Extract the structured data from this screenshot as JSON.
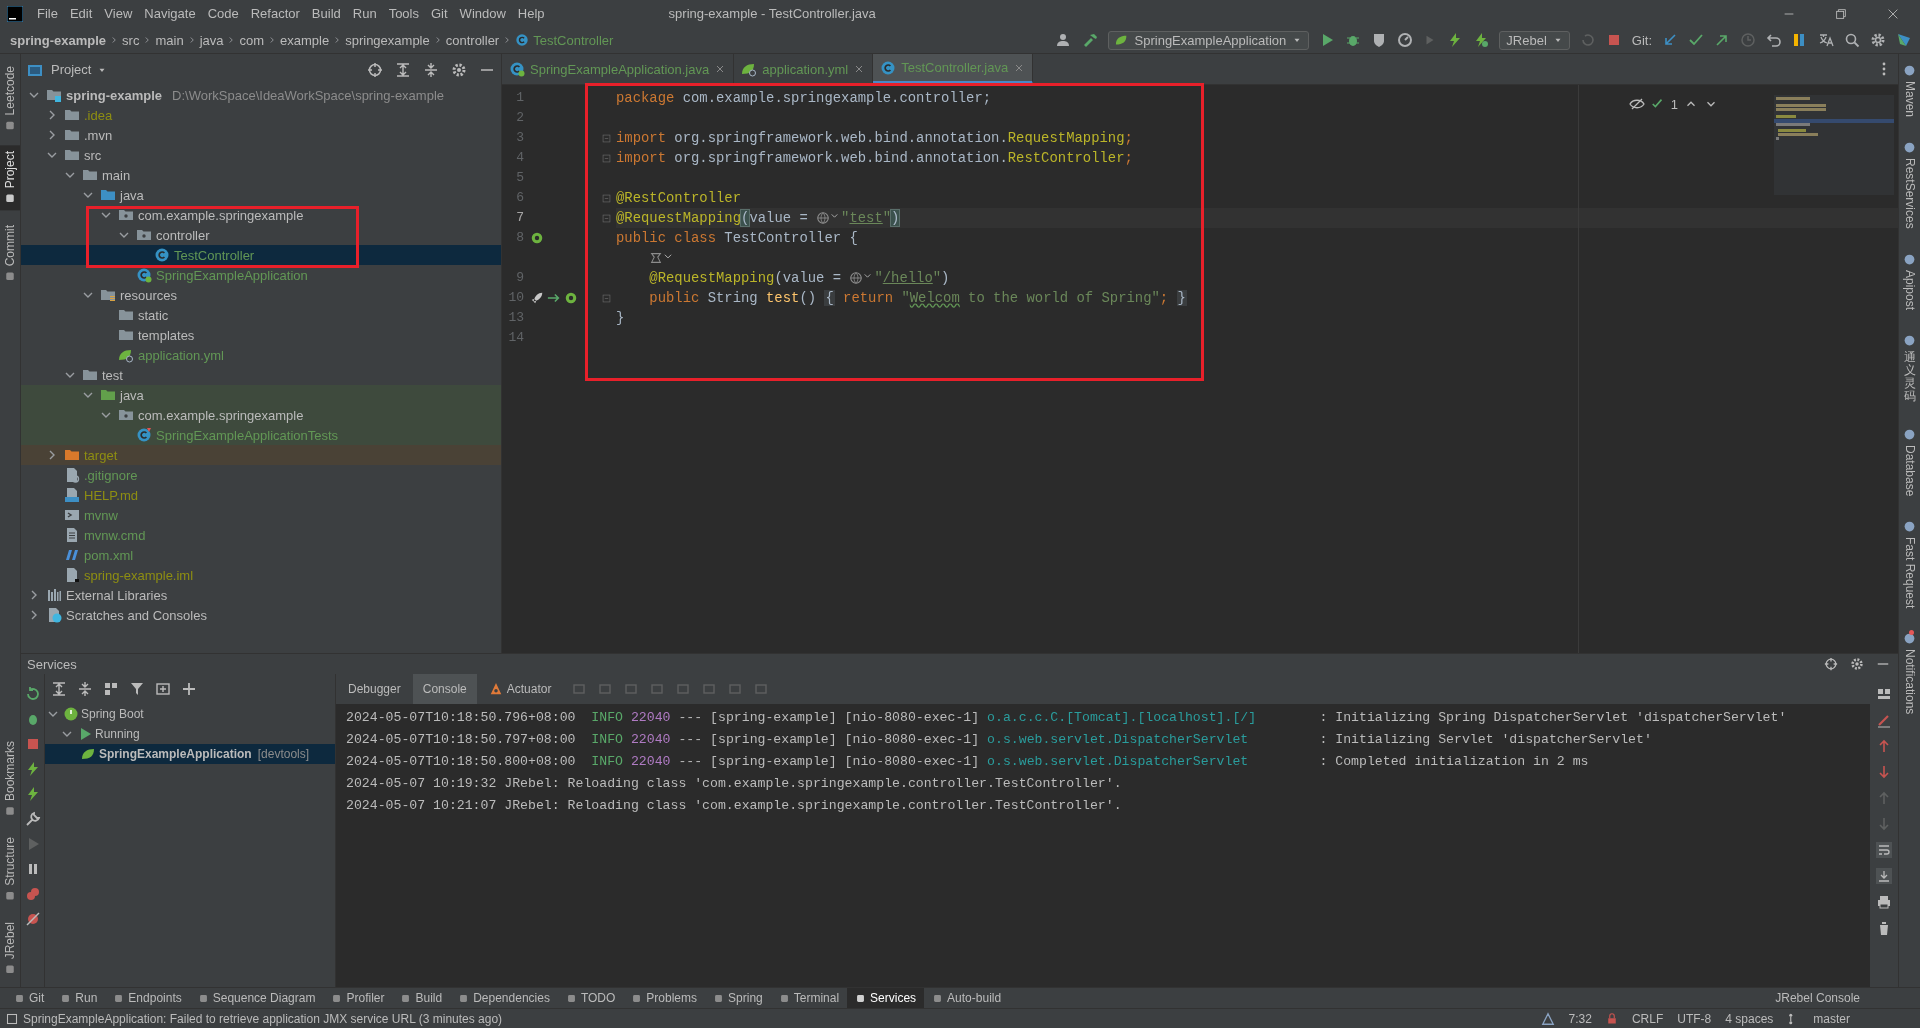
{
  "window": {
    "title": "spring-example - TestController.java"
  },
  "menu": [
    "File",
    "Edit",
    "View",
    "Navigate",
    "Code",
    "Refactor",
    "Build",
    "Run",
    "Tools",
    "Git",
    "Window",
    "Help"
  ],
  "breadcrumb": [
    "spring-example",
    "src",
    "main",
    "java",
    "com",
    "example",
    "springexample",
    "controller",
    "TestController"
  ],
  "toolbar": {
    "run_config": "SpringExampleApplication",
    "jrebel": "JRebel",
    "git_label": "Git:"
  },
  "left_stripe": {
    "top": [
      {
        "label": "Leetcode",
        "selected": false
      },
      {
        "label": "Project",
        "selected": true
      },
      {
        "label": "Commit",
        "selected": false
      }
    ],
    "bottom": [
      {
        "label": "Bookmarks",
        "selected": false
      },
      {
        "label": "Structure",
        "selected": false
      },
      {
        "label": "JRebel",
        "selected": false
      }
    ]
  },
  "right_stripe": [
    {
      "label": "Maven",
      "kind": "latin",
      "badge": false
    },
    {
      "label": "RestServices",
      "kind": "latin",
      "badge": false
    },
    {
      "label": "Apipost",
      "kind": "latin",
      "badge": false
    },
    {
      "label": "通义灵码",
      "kind": "cjk",
      "badge": false
    },
    {
      "label": "Database",
      "kind": "latin",
      "badge": false
    },
    {
      "label": "Fast Request",
      "kind": "latin",
      "badge": false
    },
    {
      "label": "Notifications",
      "kind": "latin",
      "badge": true
    }
  ],
  "project": {
    "title": "Project",
    "highlighted": true,
    "tree": [
      {
        "label": "spring-example",
        "path": "D:\\WorkSpace\\IdeaWorkSpace\\spring-example",
        "kind": "module",
        "color": "#bbbbbb",
        "selected": false,
        "expanded": true,
        "children": [
          {
            "label": ".idea",
            "kind": "folder",
            "color": "#8e8e12",
            "selected": false,
            "expanded": false
          },
          {
            "label": ".mvn",
            "kind": "folder",
            "color": "#bbbbbb",
            "selected": false,
            "expanded": false
          },
          {
            "label": "src",
            "kind": "folder",
            "color": "#bbbbbb",
            "selected": false,
            "expanded": true,
            "children": [
              {
                "label": "main",
                "kind": "folder",
                "color": "#bbbbbb",
                "selected": false,
                "expanded": true,
                "children": [
                  {
                    "label": "java",
                    "kind": "source-folder",
                    "color": "#bbbbbb",
                    "selected": false,
                    "expanded": true,
                    "children": [
                      {
                        "label": "com.example.springexample",
                        "kind": "package",
                        "color": "#bbbbbb",
                        "selected": false,
                        "expanded": true,
                        "children": [
                          {
                            "label": "controller",
                            "kind": "package",
                            "color": "#bbbbbb",
                            "selected": false,
                            "expanded": true,
                            "children": [
                              {
                                "label": "TestController",
                                "kind": "class",
                                "color": "#629755",
                                "selected": true
                              }
                            ]
                          },
                          {
                            "label": "SpringExampleApplication",
                            "kind": "spring-class",
                            "color": "#629755",
                            "selected": false
                          }
                        ]
                      }
                    ]
                  },
                  {
                    "label": "resources",
                    "kind": "resources-folder",
                    "color": "#bbbbbb",
                    "selected": false,
                    "expanded": true,
                    "children": [
                      {
                        "label": "static",
                        "kind": "folder",
                        "color": "#bbbbbb",
                        "selected": false
                      },
                      {
                        "label": "templates",
                        "kind": "folder",
                        "color": "#bbbbbb",
                        "selected": false
                      },
                      {
                        "label": "application.yml",
                        "kind": "yml",
                        "color": "#629755",
                        "selected": false
                      }
                    ]
                  }
                ]
              },
              {
                "label": "test",
                "kind": "folder",
                "color": "#bbbbbb",
                "selected": false,
                "expanded": true,
                "children": [
                  {
                    "label": "java",
                    "kind": "test-folder",
                    "color": "#bbbbbb",
                    "selected": false,
                    "in_test": true,
                    "expanded": true,
                    "children": [
                      {
                        "label": "com.example.springexample",
                        "kind": "package",
                        "color": "#bbbbbb",
                        "selected": false,
                        "in_test": true,
                        "expanded": true,
                        "children": [
                          {
                            "label": "SpringExampleApplicationTests",
                            "kind": "test-class",
                            "color": "#629755",
                            "selected": false,
                            "in_test": true
                          }
                        ]
                      }
                    ]
                  }
                ]
              }
            ]
          },
          {
            "label": "target",
            "kind": "excluded-folder",
            "color": "#8e8e12",
            "selected": false,
            "expanded": false
          },
          {
            "label": ".gitignore",
            "kind": "gitignore",
            "color": "#629755",
            "selected": false
          },
          {
            "label": "HELP.md",
            "kind": "md",
            "color": "#8e8e12",
            "selected": false
          },
          {
            "label": "mvnw",
            "kind": "script",
            "color": "#629755",
            "selected": false
          },
          {
            "label": "mvnw.cmd",
            "kind": "cmd",
            "color": "#629755",
            "selected": false
          },
          {
            "label": "pom.xml",
            "kind": "maven",
            "color": "#629755",
            "selected": false
          },
          {
            "label": "spring-example.iml",
            "kind": "iml",
            "color": "#8e8e12",
            "selected": false
          }
        ]
      },
      {
        "label": "External Libraries",
        "kind": "library",
        "color": "#bbbbbb",
        "selected": false,
        "expanded": false
      },
      {
        "label": "Scratches and Consoles",
        "kind": "scratches",
        "color": "#bbbbbb",
        "selected": false,
        "expanded": false
      }
    ]
  },
  "editor": {
    "tabs": [
      {
        "label": "SpringExampleApplication.java",
        "kind": "spring-class",
        "color": "#629755",
        "selected": false
      },
      {
        "label": "application.yml",
        "kind": "yml",
        "color": "#629755",
        "selected": false
      },
      {
        "label": "TestController.java",
        "kind": "class",
        "color": "#629755",
        "selected": true
      }
    ],
    "inspection": "1",
    "highlighted": true,
    "lines": [
      {
        "kind": "code",
        "number": "1",
        "current": false,
        "fold": false,
        "indent": false,
        "segments": [
          {
            "kind": "keyword",
            "text": "package"
          },
          {
            "kind": "plain",
            "text": " com.example.springexample.controller;"
          }
        ]
      },
      {
        "kind": "code",
        "number": "2",
        "current": false,
        "fold": false
      },
      {
        "kind": "code",
        "number": "3",
        "current": false,
        "fold": true,
        "indent": false,
        "segments": [
          {
            "kind": "keyword",
            "text": "import"
          },
          {
            "kind": "plain",
            "text": " org.springframework.web.bind.annotation."
          },
          {
            "kind": "annotation",
            "text": "RequestMapping"
          },
          {
            "kind": "keyword",
            "text": ";"
          }
        ]
      },
      {
        "kind": "code",
        "number": "4",
        "current": false,
        "fold": true,
        "indent": false,
        "segments": [
          {
            "kind": "keyword",
            "text": "import"
          },
          {
            "kind": "plain",
            "text": " org.springframework.web.bind.annotation."
          },
          {
            "kind": "annotation",
            "text": "RestController"
          },
          {
            "kind": "keyword",
            "text": ";"
          }
        ]
      },
      {
        "kind": "code",
        "number": "5",
        "current": false,
        "fold": false
      },
      {
        "kind": "code",
        "number": "6",
        "current": false,
        "fold": true,
        "indent": false,
        "segments": [
          {
            "kind": "annotation",
            "text": "@RestController"
          }
        ]
      },
      {
        "kind": "code",
        "number": "7",
        "current": true,
        "fold": true,
        "indent": false,
        "segments": [
          {
            "kind": "annotation",
            "text": "@RequestMapping"
          },
          {
            "kind": "paren",
            "text": "("
          },
          {
            "kind": "plain",
            "text": "value = "
          },
          {
            "kind": "hint"
          },
          {
            "kind": "string",
            "text": "\""
          },
          {
            "kind": "url",
            "text": "test"
          },
          {
            "kind": "string",
            "text": "\""
          },
          {
            "kind": "paren",
            "text": ")"
          }
        ]
      },
      {
        "kind": "code",
        "number": "8",
        "current": false,
        "fold": false,
        "indent": false,
        "bean": true,
        "runnable": false,
        "segments": [
          {
            "kind": "keyword",
            "text": "public class"
          },
          {
            "kind": "plain",
            "text": " TestController {"
          }
        ]
      },
      {
        "kind": "inlay"
      },
      {
        "kind": "code",
        "number": "9",
        "current": false,
        "fold": false,
        "indent": true,
        "segments": [
          {
            "kind": "annotation",
            "text": "@RequestMapping"
          },
          {
            "kind": "plain",
            "text": "(value = "
          },
          {
            "kind": "hint"
          },
          {
            "kind": "string",
            "text": "\""
          },
          {
            "kind": "url",
            "text": "/hello"
          },
          {
            "kind": "string",
            "text": "\""
          },
          {
            "kind": "plain",
            "text": ")"
          }
        ]
      },
      {
        "kind": "code",
        "number": "10",
        "current": false,
        "fold": true,
        "indent": true,
        "bean": true,
        "runnable": true,
        "segments": [
          {
            "kind": "keyword",
            "text": "public"
          },
          {
            "kind": "plain",
            "text": " String "
          },
          {
            "kind": "method",
            "text": "test"
          },
          {
            "kind": "plain",
            "text": "() "
          },
          {
            "kind": "folded",
            "text": "{"
          },
          {
            "kind": "keyword",
            "text": " return"
          },
          {
            "kind": "string",
            "text": " \""
          },
          {
            "kind": "typo",
            "text": "Welcom"
          },
          {
            "kind": "string",
            "text": " to the world of Spring\""
          },
          {
            "kind": "keyword",
            "text": "; "
          },
          {
            "kind": "folded",
            "text": "}"
          }
        ]
      },
      {
        "kind": "code",
        "number": "13",
        "current": false,
        "fold": false,
        "indent": false,
        "segments": [
          {
            "kind": "plain",
            "text": "}"
          }
        ]
      },
      {
        "kind": "code",
        "number": "14",
        "current": false,
        "fold": false
      }
    ]
  },
  "services": {
    "title": "Services",
    "tree": [
      {
        "label": "Spring Boot",
        "kind": "group",
        "selected": false,
        "expanded": true,
        "children": [
          {
            "label": "Running",
            "kind": "running",
            "selected": false,
            "expanded": true,
            "children": [
              {
                "label": "SpringExampleApplication",
                "note": "[devtools]",
                "kind": "app",
                "selected": true
              }
            ]
          }
        ]
      }
    ],
    "tabs": [
      {
        "label": "Debugger",
        "kind": "plain",
        "selected": false
      },
      {
        "label": "Console",
        "kind": "plain",
        "selected": true
      },
      {
        "label": "Actuator",
        "kind": "actuator",
        "selected": false
      }
    ],
    "console": [
      [
        {
          "kind": "time",
          "text": "2024-05-07T10:18:50.796+08:00"
        },
        {
          "kind": "level",
          "text": "INFO"
        },
        {
          "kind": "pid",
          "text": "22040"
        },
        {
          "kind": "plain",
          "text": "--- [spring-example] [nio-8080-exec-1]"
        },
        {
          "kind": "logger",
          "text": "o.a.c.c.C.[Tomcat].[localhost].[/]"
        },
        {
          "kind": "plain",
          "text": ": Initializing Spring DispatcherServlet 'dispatcherServlet'"
        }
      ],
      [
        {
          "kind": "time",
          "text": "2024-05-07T10:18:50.797+08:00"
        },
        {
          "kind": "level",
          "text": "INFO"
        },
        {
          "kind": "pid",
          "text": "22040"
        },
        {
          "kind": "plain",
          "text": "--- [spring-example] [nio-8080-exec-1]"
        },
        {
          "kind": "logger",
          "text": "o.s.web.servlet.DispatcherServlet"
        },
        {
          "kind": "plain",
          "text": ": Initializing Servlet 'dispatcherServlet'"
        }
      ],
      [
        {
          "kind": "time",
          "text": "2024-05-07T10:18:50.800+08:00"
        },
        {
          "kind": "level",
          "text": "INFO"
        },
        {
          "kind": "pid",
          "text": "22040"
        },
        {
          "kind": "plain",
          "text": "--- [spring-example] [nio-8080-exec-1]"
        },
        {
          "kind": "logger",
          "text": "o.s.web.servlet.DispatcherServlet"
        },
        {
          "kind": "plain",
          "text": ": Completed initialization in 2 ms"
        }
      ],
      [
        {
          "kind": "plain",
          "text": "2024-05-07 10:19:32 JRebel: Reloading class 'com.example.springexample.controller.TestController'."
        }
      ],
      [
        {
          "kind": "plain",
          "text": "2024-05-07 10:21:07 JRebel: Reloading class 'com.example.springexample.controller.TestController'."
        }
      ]
    ]
  },
  "tool_windows": [
    {
      "label": "Git",
      "selected": false
    },
    {
      "label": "Run",
      "selected": false
    },
    {
      "label": "Endpoints",
      "selected": false
    },
    {
      "label": "Sequence Diagram",
      "selected": false
    },
    {
      "label": "Profiler",
      "selected": false
    },
    {
      "label": "Build",
      "selected": false
    },
    {
      "label": "Dependencies",
      "selected": false
    },
    {
      "label": "TODO",
      "selected": false
    },
    {
      "label": "Problems",
      "selected": false
    },
    {
      "label": "Spring",
      "selected": false
    },
    {
      "label": "Terminal",
      "selected": false
    },
    {
      "label": "Services",
      "selected": true
    },
    {
      "label": "Auto-build",
      "selected": false
    }
  ],
  "jrebel_console": "JRebel Console",
  "status": {
    "message": "SpringExampleApplication: Failed to retrieve application JMX service URL (3 minutes ago)",
    "items": [
      "7:32",
      "CRLF",
      "UTF-8",
      "4 spaces",
      "master"
    ]
  }
}
